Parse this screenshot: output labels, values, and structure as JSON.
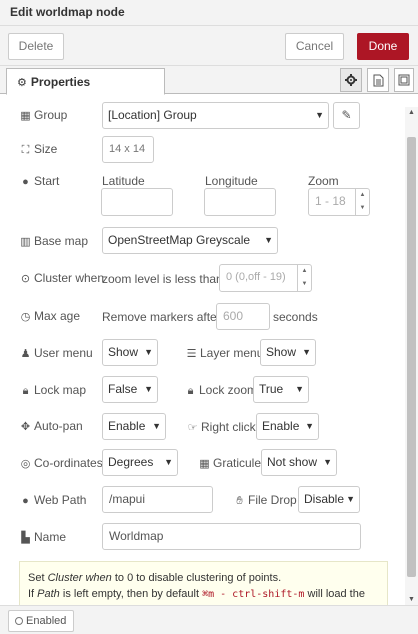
{
  "title": "Edit worldmap node",
  "buttons": {
    "delete": "Delete",
    "cancel": "Cancel",
    "done": "Done"
  },
  "tab": {
    "label": "Properties"
  },
  "fields": {
    "group": {
      "label": "Group",
      "value": "[Location] Group"
    },
    "size": {
      "label": "Size",
      "value": "14 x 14"
    },
    "start": {
      "label": "Start",
      "latitude": "Latitude",
      "longitude": "Longitude",
      "zoom": "Zoom",
      "zoom_placeholder": "1 - 18"
    },
    "basemap": {
      "label": "Base map",
      "value": "OpenStreetMap Greyscale"
    },
    "cluster": {
      "label": "Cluster when",
      "text": "zoom level is less than",
      "placeholder": "0 (0,off - 19)"
    },
    "maxage": {
      "label": "Max age",
      "text": "Remove markers after",
      "placeholder": "600",
      "unit": "seconds"
    },
    "usermenu": {
      "label": "User menu",
      "value": "Show"
    },
    "layermenu": {
      "label": "Layer menu",
      "value": "Show"
    },
    "lockmap": {
      "label": "Lock map",
      "value": "False"
    },
    "lockzoom": {
      "label": "Lock zoom",
      "value": "True"
    },
    "autopan": {
      "label": "Auto-pan",
      "value": "Enable"
    },
    "rightclick": {
      "label": "Right click",
      "value": "Enable"
    },
    "coords": {
      "label": "Co-ordinates",
      "value": "Degrees"
    },
    "graticule": {
      "label": "Graticule",
      "value": "Not show"
    },
    "webpath": {
      "label": "Web Path",
      "value": "/mapui"
    },
    "filedrop": {
      "label": "File Drop",
      "value": "Disable"
    },
    "name": {
      "label": "Name",
      "value": "Worldmap"
    }
  },
  "tip": {
    "line1_pre": "Set ",
    "line1_em": "Cluster when",
    "line1_post": " to 0 to disable clustering of points.",
    "line2_pre": "If ",
    "line2_em": "Path",
    "line2_mid": " is left empty, then by default ",
    "line2_code": "⌘m - ctrl-shift-m",
    "line2_post": " will load the"
  },
  "footer": {
    "enabled": "Enabled"
  }
}
